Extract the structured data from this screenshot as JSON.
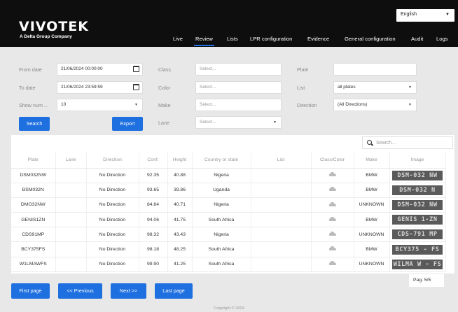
{
  "brand": {
    "logo": "VIVOTEK",
    "tagline": "A Delta Group Company"
  },
  "language": {
    "selected": "English"
  },
  "nav": [
    "Live",
    "Review",
    "Lists",
    "LPR configuration",
    "Evidence",
    "General configuration",
    "Audit",
    "Logs"
  ],
  "active_nav": "Review",
  "filters": {
    "from_date_label": "From date",
    "from_date_value": "21/06/2024 00:00:00",
    "to_date_label": "To date",
    "to_date_value": "21/06/2024 23:59:59",
    "show_num_label": "Show num ...",
    "show_num_value": "10",
    "class_label": "Class",
    "class_placeholder": "Select...",
    "color_label": "Color",
    "color_placeholder": "Select...",
    "make_label": "Make",
    "make_placeholder": "Select...",
    "lane_label": "Lane",
    "lane_placeholder": "Select...",
    "plate_label": "Plate",
    "plate_value": "",
    "list_label": "List",
    "list_value": "all plates",
    "direction_label": "Direction",
    "direction_value": "(All Directions)"
  },
  "buttons": {
    "search": "Search",
    "export": "Export"
  },
  "table_search": {
    "placeholder": "Search..."
  },
  "table": {
    "headers": [
      "Plate",
      "Lane",
      "Direction",
      "Conf.",
      "Height",
      "Country or state",
      "List",
      "Class/Color",
      "Make",
      "Image"
    ],
    "rows": [
      {
        "plate": "DSM032NW",
        "lane": "",
        "direction": "No Direction",
        "conf": "92.35",
        "height": "40.88",
        "country": "Nigeria",
        "list": "",
        "make": "BMW",
        "image_text": "DSM-032 NW"
      },
      {
        "plate": "BSM032N",
        "lane": "",
        "direction": "No Direction",
        "conf": "93.65",
        "height": "39.86",
        "country": "Uganda",
        "list": "",
        "make": "BMW",
        "image_text": "DSM-032 N"
      },
      {
        "plate": "DMO32NW",
        "lane": "",
        "direction": "No Direction",
        "conf": "84.84",
        "height": "40.71",
        "country": "Nigeria",
        "list": "",
        "make": "UNKNOWN",
        "image_text": "DSM-032 NW"
      },
      {
        "plate": "GENIS1ZN",
        "lane": "",
        "direction": "No Direction",
        "conf": "94.06",
        "height": "41.75",
        "country": "South Africa",
        "list": "",
        "make": "BMW",
        "image_text": "GENIS 1-ZN"
      },
      {
        "plate": "CDS91MP",
        "lane": "",
        "direction": "No Direction",
        "conf": "98.32",
        "height": "43.43",
        "country": "Nigeria",
        "list": "",
        "make": "UNKNOWN",
        "image_text": "CDS-791 MP"
      },
      {
        "plate": "BCY375FS",
        "lane": "",
        "direction": "No Direction",
        "conf": "98.18",
        "height": "48.25",
        "country": "South Africa",
        "list": "",
        "make": "BMW",
        "image_text": "BCY375 - FS"
      },
      {
        "plate": "W1LMAWFS",
        "lane": "",
        "direction": "No Direction",
        "conf": "99.90",
        "height": "41.25",
        "country": "South Africa",
        "list": "",
        "make": "UNKNOWN",
        "image_text": "WILMA W - FS"
      }
    ]
  },
  "pagination": {
    "first": "First page",
    "previous": "<< Previous",
    "next": "Next >>",
    "last": "Last page",
    "page_info": "Pag. 5/5"
  },
  "footer": {
    "copyright": "Copyright © 2024"
  },
  "colors": {
    "accent": "#1e6fe0",
    "header_bg": "#0e0e0e",
    "page_bg": "#e8e8e8"
  }
}
